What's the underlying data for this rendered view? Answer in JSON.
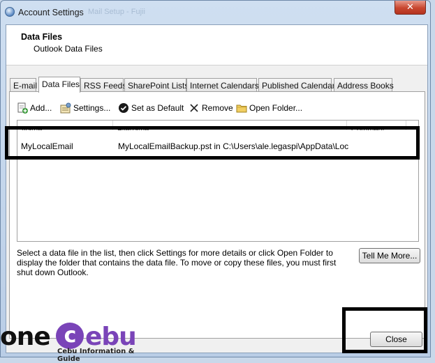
{
  "window": {
    "title": "Account Settings",
    "ghost_title": "Mail Setup - Fujii",
    "close_glyph": "✕"
  },
  "header": {
    "title": "Data Files",
    "subtitle": "Outlook Data Files"
  },
  "tabs": [
    {
      "label": "E-mail",
      "active": false
    },
    {
      "label": "Data Files",
      "active": true
    },
    {
      "label": "RSS Feeds",
      "active": false
    },
    {
      "label": "SharePoint Lists",
      "active": false
    },
    {
      "label": "Internet Calendars",
      "active": false
    },
    {
      "label": "Published Calendars",
      "active": false
    },
    {
      "label": "Address Books",
      "active": false
    }
  ],
  "toolbar": {
    "add_label": "Add...",
    "settings_label": "Settings...",
    "set_default_label": "Set as Default",
    "remove_label": "Remove",
    "open_folder_label": "Open Folder..."
  },
  "list": {
    "columns": [
      "Name",
      "Filename",
      "Comment"
    ],
    "rows": [
      {
        "name": "MyLocalEmail",
        "filename": "MyLocalEmailBackup.pst in C:\\Users\\ale.legaspi\\AppData\\Local\\...",
        "comment": ""
      }
    ]
  },
  "description": "Select a data file in the list, then click Settings for more details or click Open Folder to display the folder that contains the data file. To move or copy these files, you must first shut down Outlook.",
  "buttons": {
    "tell_me_more": "Tell Me More...",
    "close": "Close"
  },
  "watermark": {
    "word_a": "one",
    "word_b": "c",
    "word_c": "ebu",
    "tagline": "Cebu Information & Guide"
  },
  "colors": {
    "highlight": "#000000",
    "watermark_purple": "#7a44b8",
    "close_red": "#c8462f"
  },
  "icons": {
    "app": "outlook-globe-icon",
    "add": "add-file-icon",
    "settings": "settings-icon",
    "set_default": "checkmark-circle-icon",
    "remove": "x-icon",
    "open_folder": "folder-icon"
  }
}
